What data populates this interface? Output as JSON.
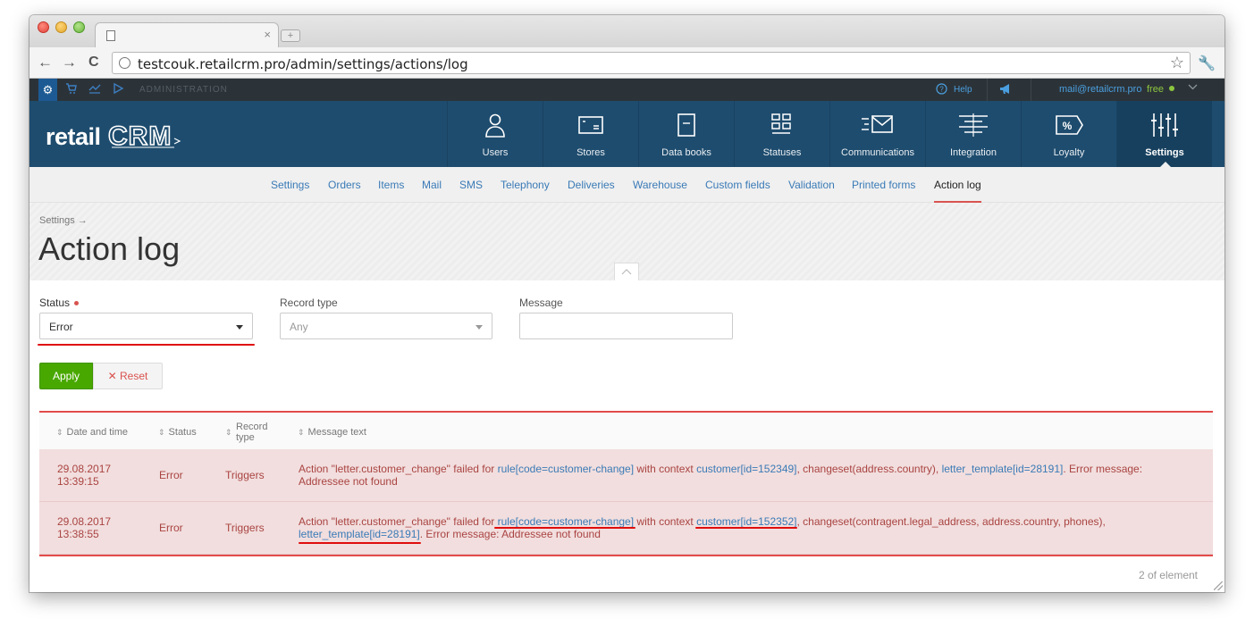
{
  "browser": {
    "url": "testcouk.retailcrm.pro/admin/settings/actions/log",
    "new_tab": "+",
    "tab_close": "×",
    "nav_back": "←",
    "nav_forward": "→",
    "nav_reload": "C",
    "bookmark_star": "☆",
    "menu": "🔧"
  },
  "admin_bar": {
    "label": "ADMINISTRATION",
    "help": "Help",
    "email": "mail@retailcrm.pro",
    "plan": "free",
    "icons": [
      "gear-icon",
      "cart-icon",
      "analytics-icon",
      "play-icon"
    ]
  },
  "header": {
    "logo": "retailCRM",
    "nav": [
      {
        "label": "Users",
        "icon": "user-icon"
      },
      {
        "label": "Stores",
        "icon": "store-icon"
      },
      {
        "label": "Data books",
        "icon": "book-icon"
      },
      {
        "label": "Statuses",
        "icon": "statuses-icon"
      },
      {
        "label": "Communications",
        "icon": "mail-icon"
      },
      {
        "label": "Integration",
        "icon": "integration-icon"
      },
      {
        "label": "Loyalty",
        "icon": "percent-tag-icon"
      },
      {
        "label": "Settings",
        "icon": "sliders-icon",
        "active": true
      }
    ]
  },
  "subnav": {
    "items": [
      "Settings",
      "Orders",
      "Items",
      "Mail",
      "SMS",
      "Telephony",
      "Deliveries",
      "Warehouse",
      "Custom fields",
      "Validation",
      "Printed forms",
      "Action log"
    ],
    "active": "Action log"
  },
  "page": {
    "breadcrumb": "Settings →",
    "title": "Action log"
  },
  "filters": {
    "status_label": "Status",
    "status_value": "Error",
    "record_type_label": "Record type",
    "record_type_value": "Any",
    "message_label": "Message",
    "message_value": "",
    "apply": "Apply",
    "reset": "Reset",
    "reset_icon": "✕"
  },
  "table": {
    "columns": [
      "Date and time",
      "Status",
      "Record type",
      "Message text"
    ],
    "column_record_line1": "Record",
    "column_record_line2": "type",
    "rows": [
      {
        "date": "29.08.2017",
        "time": "13:39:15",
        "status": "Error",
        "type": "Triggers",
        "msg_p1": "Action \"letter.customer_change\" failed for ",
        "rule": "rule[code=customer-change]",
        "msg_p2": " with context ",
        "customer": "customer[id=152349]",
        "msg_p3": ", changeset(address.country), ",
        "template": "letter_template[id=28191]",
        "msg_p4": ". Error message:",
        "msg_line2": "Addressee not found"
      },
      {
        "date": "29.08.2017",
        "time": "13:38:55",
        "status": "Error",
        "type": "Triggers",
        "msg_p1": "Action \"letter.customer_change\" failed for ",
        "rule": "rule[code=customer-change]",
        "msg_p2": " with context ",
        "customer": "customer[id=152352]",
        "msg_p3": ", changeset(contragent.legal_address, address.country, phones),",
        "template": "letter_template[id=28191]",
        "msg_p4": ". Error message: Addressee not found"
      }
    ],
    "count": "2 of element"
  },
  "colors": {
    "header_bg": "#1e4c6e",
    "admin_bar_bg": "#2c3338",
    "apply_green": "#49a800",
    "error_row_bg": "#f2dede",
    "error_text": "#a94442",
    "link": "#3a7ab6",
    "annotation_red": "#e00d0d"
  }
}
